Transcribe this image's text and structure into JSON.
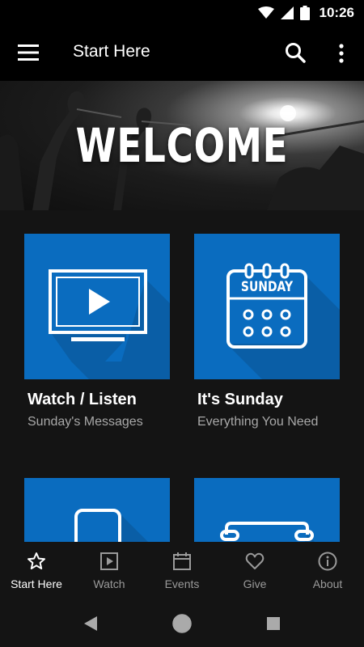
{
  "status_bar": {
    "time": "10:26"
  },
  "app_bar": {
    "title": "Start Here"
  },
  "hero": {
    "text": "WELCOME"
  },
  "cards": [
    {
      "title": "Watch / Listen",
      "subtitle": "Sunday's Messages",
      "icon": "tv-play-icon"
    },
    {
      "title": "It's Sunday",
      "subtitle": "Everything You Need",
      "icon": "calendar-icon",
      "icon_text": "SUNDAY"
    },
    {
      "title": "",
      "subtitle": "",
      "icon": "phone-icon"
    },
    {
      "title": "",
      "subtitle": "",
      "icon": "board-icon"
    }
  ],
  "bottom_nav": [
    {
      "label": "Start Here",
      "icon": "star-icon",
      "active": true
    },
    {
      "label": "Watch",
      "icon": "play-icon"
    },
    {
      "label": "Events",
      "icon": "calendar-icon"
    },
    {
      "label": "Give",
      "icon": "heart-icon"
    },
    {
      "label": "About",
      "icon": "info-icon"
    }
  ],
  "colors": {
    "accent": "#0a6cbf",
    "background": "#141414",
    "bar": "#000000"
  }
}
